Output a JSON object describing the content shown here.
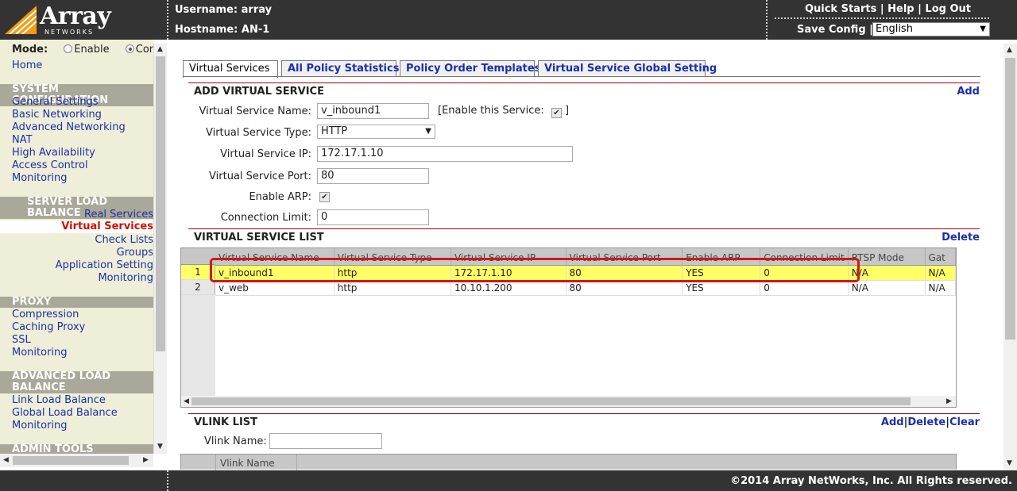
{
  "brand": {
    "name": "Array",
    "sub": "NETWORKS"
  },
  "header": {
    "username_label": "Username: array",
    "hostname_label": "Hostname: AN-1",
    "quick_starts": "Quick Starts",
    "help": "Help",
    "log_out": "Log Out",
    "save_config": "Save Config |",
    "language": "English",
    "sep1": "|",
    "sep2": "|"
  },
  "sidebar": {
    "mode_label": "Mode:",
    "mode_enable": "Enable",
    "mode_config": "Config",
    "home": "Home",
    "sections": {
      "system": "SYSTEM CONFIGURATION",
      "slb": "SERVER LOAD BALANCE",
      "proxy": "PROXY",
      "alb": "ADVANCED LOAD BALANCE",
      "admin": "ADMIN TOOLS"
    },
    "system_items": [
      "General Settings",
      "Basic Networking",
      "Advanced Networking",
      "NAT",
      "High Availability",
      "Access Control",
      "Monitoring"
    ],
    "slb_items": [
      "Real Services",
      "Virtual Services",
      "Check Lists",
      "Groups",
      "Application Setting",
      "Monitoring"
    ],
    "proxy_items": [
      "Compression",
      "Caching Proxy",
      "SSL",
      "Monitoring"
    ],
    "alb_items": [
      "Link Load Balance",
      "Global Load Balance",
      "Monitoring"
    ]
  },
  "tabs": [
    "Virtual Services",
    "All Policy Statistics",
    "Policy Order Templates",
    "Virtual Service Global Setting"
  ],
  "add_section": {
    "title": "ADD VIRTUAL SERVICE",
    "action": "Add",
    "name_label": "Virtual Service Name:",
    "name_value": "v_inbound1",
    "enable_label_open": "[Enable this Service:",
    "enable_label_close": "]",
    "type_label": "Virtual Service Type:",
    "type_value": "HTTP",
    "ip_label": "Virtual Service IP:",
    "ip_value": "172.17.1.10",
    "port_label": "Virtual Service Port:",
    "port_value": "80",
    "arp_label": "Enable ARP:",
    "limit_label": "Connection Limit:",
    "limit_value": "0",
    "checkmark": "✔"
  },
  "list_section": {
    "title": "VIRTUAL SERVICE LIST",
    "action": "Delete",
    "columns": [
      "Virtual Service Name",
      "Virtual Service Type",
      "Virtual Service IP",
      "Virtual Service Port",
      "Enable ARP",
      "Connection Limit",
      "RTSP Mode",
      "Gat"
    ],
    "rows": [
      {
        "num": "1",
        "cells": [
          "v_inbound1",
          "http",
          "172.17.1.10",
          "80",
          "YES",
          "0",
          "N/A",
          "N/A"
        ]
      },
      {
        "num": "2",
        "cells": [
          "v_web",
          "http",
          "10.10.1.200",
          "80",
          "YES",
          "0",
          "N/A",
          "N/A"
        ]
      }
    ]
  },
  "vlink_section": {
    "title": "VLINK LIST",
    "add": "Add",
    "delete": "Delete",
    "clear": "Clear",
    "pipe": "|",
    "name_label": "Vlink Name:",
    "col_name": "Vlink Name"
  },
  "footer": {
    "copyright": "©2014 Array NetWorks, Inc. All Rights reserved."
  },
  "colors": {
    "header_bg": "#333333",
    "sidebar_bg": "#efefd9",
    "link": "#1a2fa8",
    "active": "#cc1100",
    "highlight": "#ffff66",
    "section_rule": "#a0001a"
  }
}
